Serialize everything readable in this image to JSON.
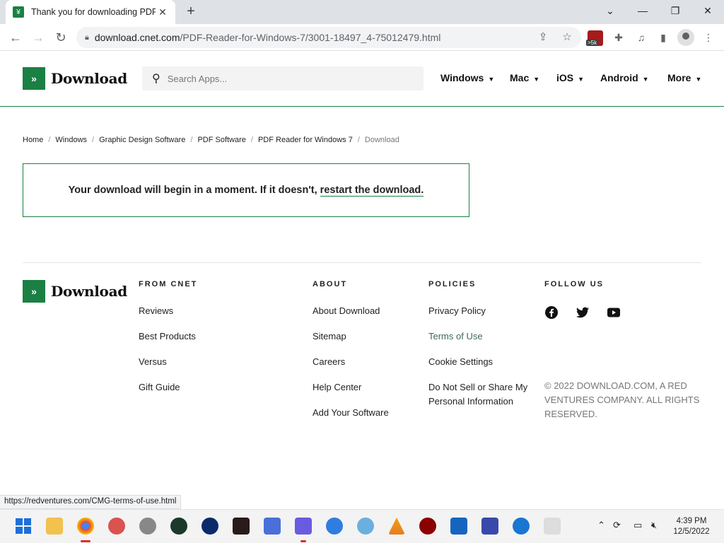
{
  "browser": {
    "tab_title": "Thank you for downloading PDF",
    "url_host": "download.cnet.com",
    "url_path": "/PDF-Reader-for-Windows-7/3001-18497_4-75012479.html",
    "extension_badge": ">5k",
    "status_url": "https://redventures.com/CMG-terms-of-use.html"
  },
  "header": {
    "logo_text": "Download",
    "search_placeholder": "Search Apps...",
    "nav": [
      "Windows",
      "Mac",
      "iOS",
      "Android",
      "More"
    ]
  },
  "breadcrumb": [
    "Home",
    "Windows",
    "Graphic Design Software",
    "PDF Software",
    "PDF Reader for Windows 7",
    "Download"
  ],
  "notice": {
    "text": "Your download will begin in a moment. If it doesn't,",
    "link": "restart the download."
  },
  "footer": {
    "logo_text": "Download",
    "columns": [
      {
        "heading": "FROM CNET",
        "links": [
          "Reviews",
          "Best Products",
          "Versus",
          "Gift Guide"
        ]
      },
      {
        "heading": "ABOUT",
        "links": [
          "About Download",
          "Sitemap",
          "Careers",
          "Help Center",
          "Add Your Software"
        ]
      },
      {
        "heading": "POLICIES",
        "links": [
          "Privacy Policy",
          "Terms of Use",
          "Cookie Settings",
          "Do Not Sell or Share My Personal Information"
        ]
      },
      {
        "heading": "FOLLOW US",
        "social": [
          "facebook-icon",
          "twitter-icon",
          "youtube-icon"
        ]
      }
    ],
    "copyright": "© 2022 DOWNLOAD.COM, A RED VENTURES COMPANY. ALL RIGHTS RESERVED."
  },
  "taskbar": {
    "time": "4:39 PM",
    "date": "12/5/2022"
  },
  "colors": {
    "brand_green": "#1a8043"
  }
}
